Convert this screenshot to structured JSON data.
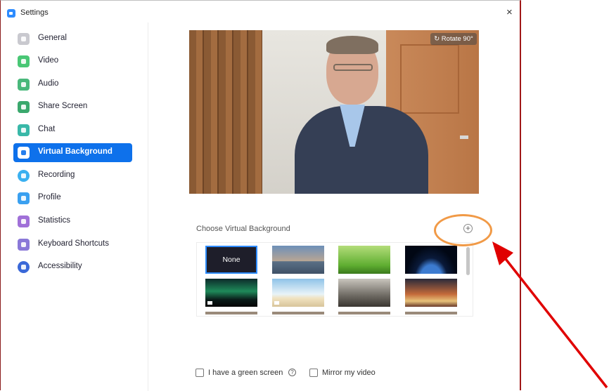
{
  "window": {
    "title": "Settings",
    "close_glyph": "×"
  },
  "sidebar": {
    "items": [
      {
        "label": "General",
        "icon": "gear-icon",
        "color": "#c9c9cf",
        "active": false
      },
      {
        "label": "Video",
        "icon": "video-icon",
        "color": "#49c775",
        "active": false
      },
      {
        "label": "Audio",
        "icon": "headphones-icon",
        "color": "#49b87b",
        "active": false
      },
      {
        "label": "Share Screen",
        "icon": "share-screen-icon",
        "color": "#3aa86d",
        "active": false
      },
      {
        "label": "Chat",
        "icon": "chat-icon",
        "color": "#39b8a8",
        "active": false
      },
      {
        "label": "Virtual Background",
        "icon": "person-background-icon",
        "color": "#ffffff",
        "active": true
      },
      {
        "label": "Recording",
        "icon": "record-icon",
        "color": "#3ab0f0",
        "active": false
      },
      {
        "label": "Profile",
        "icon": "profile-icon",
        "color": "#3aa0f0",
        "active": false
      },
      {
        "label": "Statistics",
        "icon": "statistics-icon",
        "color": "#a070d8",
        "active": false
      },
      {
        "label": "Keyboard Shortcuts",
        "icon": "keyboard-icon",
        "color": "#8a78d8",
        "active": false
      },
      {
        "label": "Accessibility",
        "icon": "accessibility-icon",
        "color": "#3a68d8",
        "active": false
      }
    ]
  },
  "preview": {
    "rotate_label": "Rotate 90°"
  },
  "backgrounds": {
    "label": "Choose Virtual Background",
    "add_glyph": "+",
    "none_label": "None",
    "thumbnails": [
      {
        "name": "golden-gate-bridge",
        "video": false
      },
      {
        "name": "grass",
        "video": false
      },
      {
        "name": "earth-from-space",
        "video": false
      },
      {
        "name": "aurora",
        "video": true
      },
      {
        "name": "beach",
        "video": true
      },
      {
        "name": "building",
        "video": false
      },
      {
        "name": "concert-hall",
        "video": false
      }
    ]
  },
  "options": {
    "green_screen_label": "I have a green screen",
    "help_glyph": "?",
    "mirror_label": "Mirror my video"
  },
  "colors": {
    "accent": "#0e71eb",
    "annotation_circle": "#f19a47",
    "annotation_arrow": "#e00000"
  }
}
